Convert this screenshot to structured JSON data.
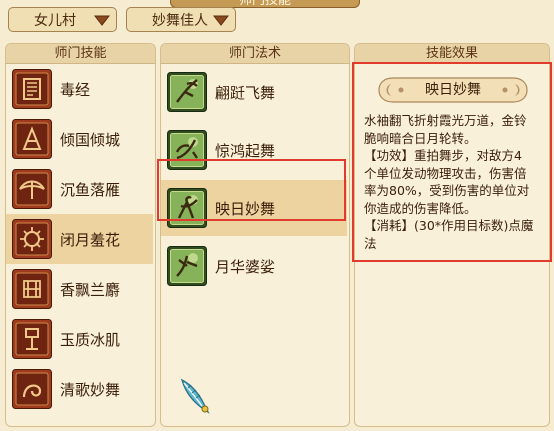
{
  "window": {
    "title": "师门技能"
  },
  "filters": {
    "sect": "女儿村",
    "category": "妙舞佳人"
  },
  "skills_panel": {
    "header": "师门技能",
    "items": [
      {
        "label": "毒经",
        "icon": "poison-scroll-icon"
      },
      {
        "label": "倾国倾城",
        "icon": "kneeling-figure-icon"
      },
      {
        "label": "沉鱼落雁",
        "icon": "bird-icon"
      },
      {
        "label": "闭月羞花",
        "icon": "flower-icon",
        "selected": true
      },
      {
        "label": "香飘兰麝",
        "icon": "orchid-icon"
      },
      {
        "label": "玉质冰肌",
        "icon": "jade-figure-icon"
      },
      {
        "label": "清歌妙舞",
        "icon": "dance-ribbon-icon"
      }
    ]
  },
  "spells_panel": {
    "header": "师门法术",
    "items": [
      {
        "label": "翩跹飞舞",
        "icon": "dancer-flying-icon"
      },
      {
        "label": "惊鸿起舞",
        "icon": "dancer-leaping-icon"
      },
      {
        "label": "映日妙舞",
        "icon": "dancer-sun-icon",
        "selected": true
      },
      {
        "label": "月华婆娑",
        "icon": "dancer-moon-icon"
      }
    ]
  },
  "effect_panel": {
    "header": "技能效果",
    "spell_name": "映日妙舞",
    "description_lines": [
      "水袖翻飞折射霞光万道，金铃",
      "脆响暗合日月轮转。",
      "【功效】重拍舞步，对敌方4",
      "个单位发动物理攻击，伤害倍",
      "率为80%，受到伤害的单位对",
      "你造成的伤害降低。",
      "【消耗】(30*作用目标数)点魔",
      "法"
    ]
  },
  "colors": {
    "highlight_box": "#e13b2d",
    "selected_row": "#ecd3a0"
  }
}
